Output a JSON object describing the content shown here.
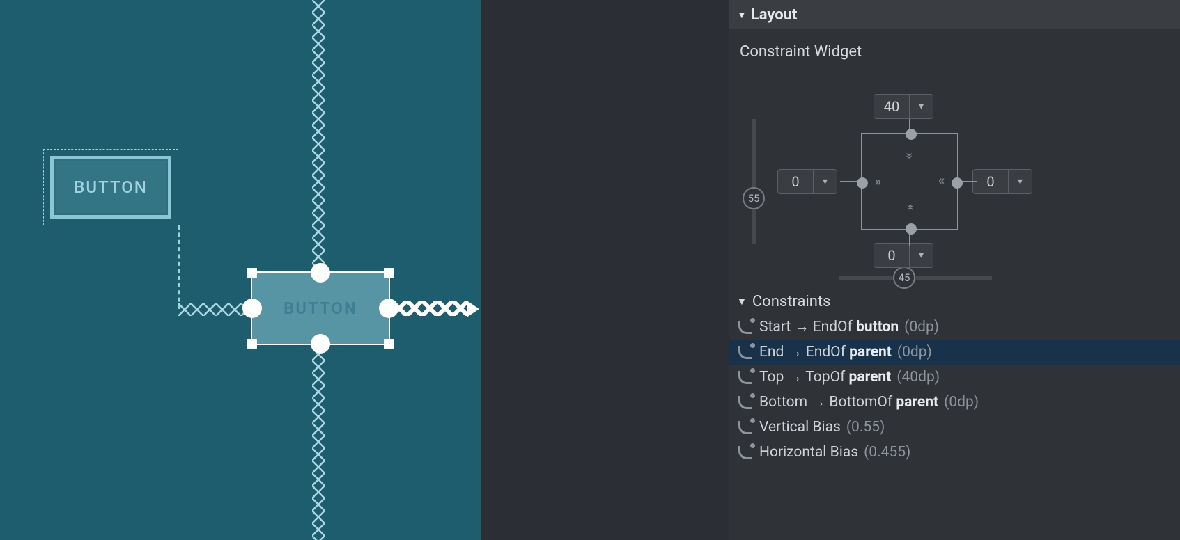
{
  "canvas": {
    "button1_label": "BUTTON",
    "button2_label": "BUTTON"
  },
  "layout_panel": {
    "title": "Layout",
    "widget_title": "Constraint Widget",
    "margins": {
      "top": "40",
      "left": "0",
      "right": "0",
      "bottom": "0"
    },
    "vertical_bias_badge": "55",
    "horizontal_bias_badge": "45",
    "constraints_title": "Constraints",
    "constraints": [
      {
        "label_a": "Start",
        "arrow": "→",
        "label_b": "EndOf",
        "target": "button",
        "value": "(0dp)",
        "selected": false
      },
      {
        "label_a": "End",
        "arrow": "→",
        "label_b": "EndOf",
        "target": "parent",
        "value": "(0dp)",
        "selected": true
      },
      {
        "label_a": "Top",
        "arrow": "→",
        "label_b": "TopOf",
        "target": "parent",
        "value": "(40dp)",
        "selected": false
      },
      {
        "label_a": "Bottom",
        "arrow": "→",
        "label_b": "BottomOf",
        "target": "parent",
        "value": "(0dp)",
        "selected": false
      },
      {
        "label_a": "Vertical Bias",
        "arrow": "",
        "label_b": "",
        "target": "",
        "value": "(0.55)",
        "selected": false
      },
      {
        "label_a": "Horizontal Bias",
        "arrow": "",
        "label_b": "",
        "target": "",
        "value": "(0.455)",
        "selected": false
      }
    ]
  }
}
